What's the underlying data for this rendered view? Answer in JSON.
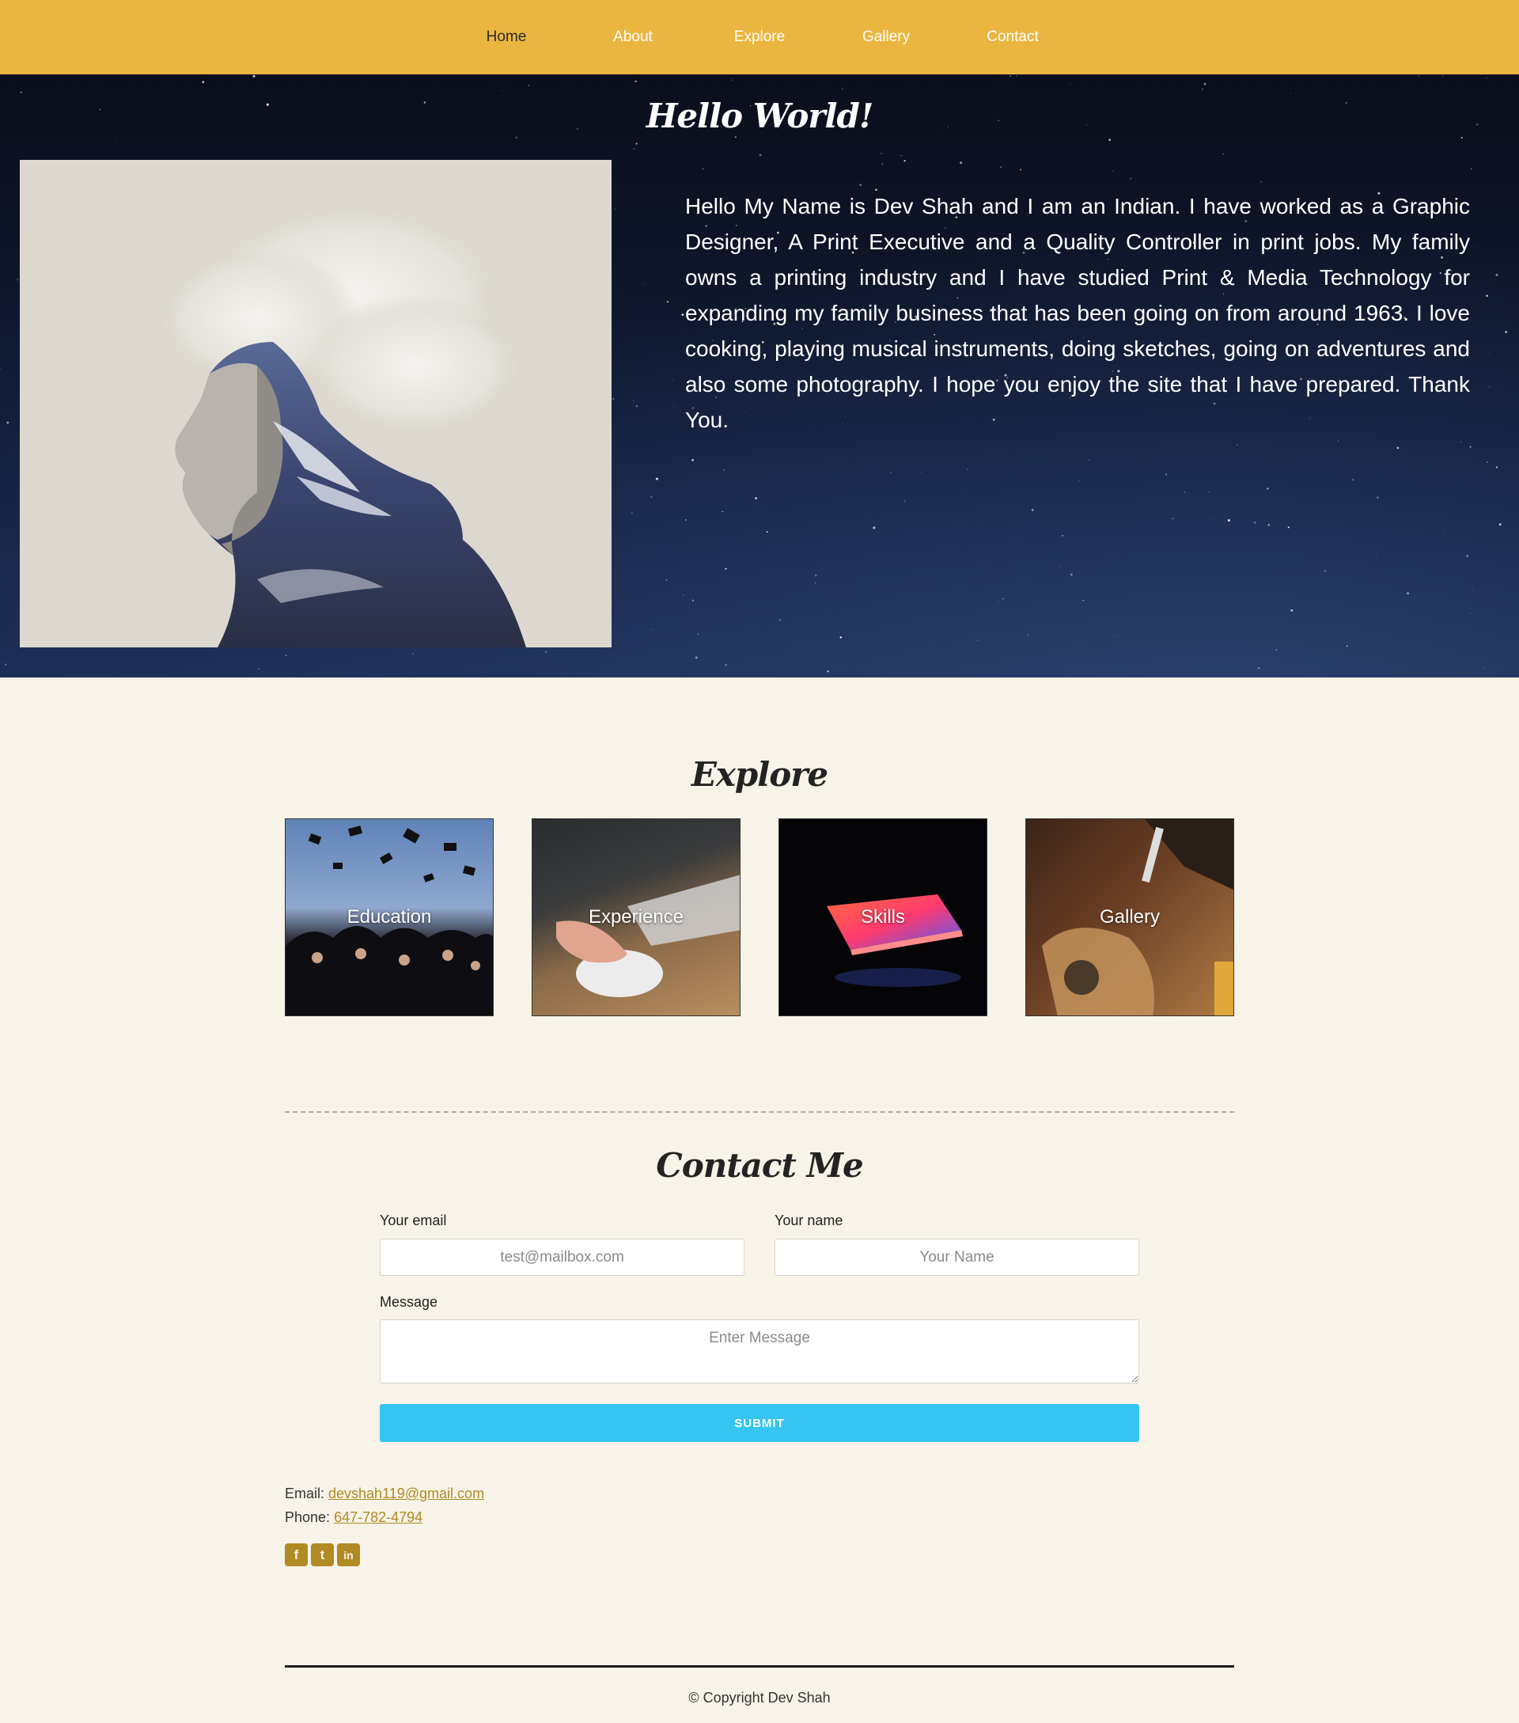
{
  "nav": {
    "items": [
      {
        "label": "Home"
      },
      {
        "label": "About"
      },
      {
        "label": "Explore"
      },
      {
        "label": "Gallery"
      },
      {
        "label": "Contact"
      }
    ],
    "accent": "#ebb640"
  },
  "hero": {
    "title": "Hello World!",
    "bio": "Hello My Name is Dev Shah and I am an Indian. I have worked as a Graphic Designer, A Print Executive and a Quality Controller in print jobs. My family owns a printing industry and I have studied Print & Media Technology for expanding my family business that has been going on from around 1963. I love cooking, playing musical instruments, doing sketches, going on adventures and also some photography. I hope you enjoy the site that I have prepared. Thank You."
  },
  "explore": {
    "title": "Explore",
    "tiles": [
      {
        "label": "Education"
      },
      {
        "label": "Experience"
      },
      {
        "label": "Skills"
      },
      {
        "label": "Gallery"
      }
    ]
  },
  "contact": {
    "title": "Contact Me",
    "email_label": "Your email",
    "email_placeholder": "test@mailbox.com",
    "name_label": "Your name",
    "name_placeholder": "Your Name",
    "message_label": "Message",
    "message_placeholder": "Enter Message",
    "submit_label": "SUBMIT",
    "submit_color": "#36c5f0"
  },
  "info": {
    "email_prefix": "Email: ",
    "email": "devshah119@gmail.com",
    "phone_prefix": "Phone: ",
    "phone": "647-782-4794"
  },
  "social": [
    {
      "icon": "facebook-icon",
      "glyph": "f"
    },
    {
      "icon": "twitter-icon",
      "glyph": "t"
    },
    {
      "icon": "linkedin-icon",
      "glyph": "in"
    }
  ],
  "footer": {
    "copyright": "© Copyright Dev Shah"
  }
}
